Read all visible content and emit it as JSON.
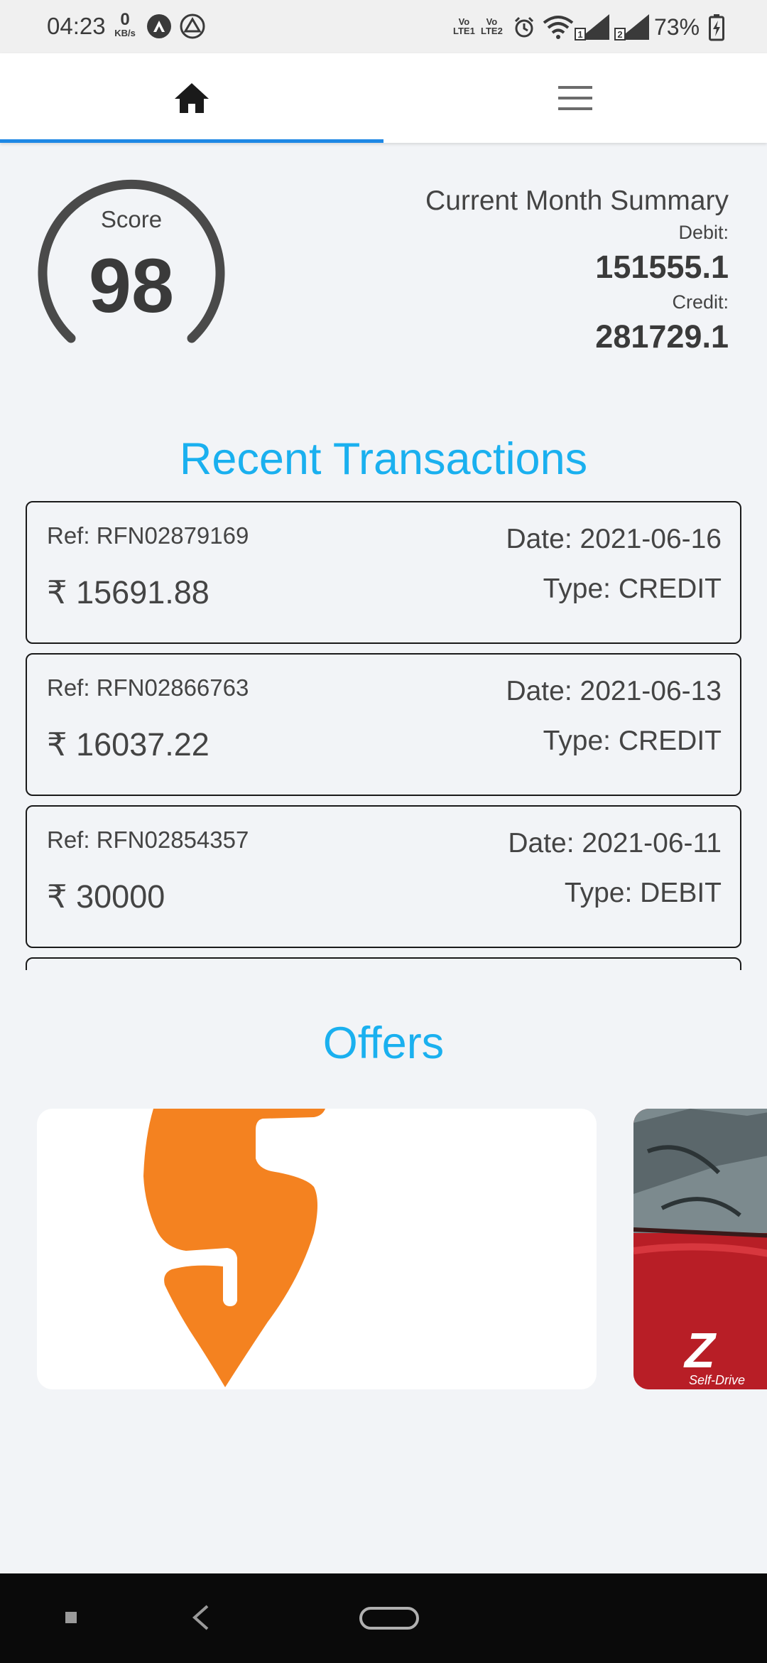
{
  "status_bar": {
    "time": "04:23",
    "net_speed_value": "0",
    "net_speed_unit": "KB/s",
    "volte1": "Vo\nLTE1",
    "volte2": "Vo\nLTE2",
    "battery": "73%",
    "icons": [
      "app-notification-icon",
      "drive-icon",
      "alarm-icon",
      "wifi-icon",
      "signal-sim1-icon",
      "signal-sim2-icon",
      "battery-charging-icon"
    ]
  },
  "nav": {
    "tabs": [
      {
        "name": "home",
        "icon": "home-icon",
        "active": true
      },
      {
        "name": "menu",
        "icon": "menu-icon",
        "active": false
      }
    ],
    "accent": "#1e88e5"
  },
  "score": {
    "label": "Score",
    "value": "98"
  },
  "summary": {
    "title": "Current Month Summary",
    "debit_label": "Debit:",
    "debit_value": "151555.1",
    "credit_label": "Credit:",
    "credit_value": "281729.1"
  },
  "recent_transactions": {
    "heading": "Recent Transactions",
    "items": [
      {
        "ref": "Ref: RFN02879169",
        "amount": "₹ 15691.88",
        "date": "Date: 2021-06-16",
        "type": "Type: CREDIT"
      },
      {
        "ref": "Ref: RFN02866763",
        "amount": "₹ 16037.22",
        "date": "Date: 2021-06-13",
        "type": "Type: CREDIT"
      },
      {
        "ref": "Ref: RFN02854357",
        "amount": "₹ 30000",
        "date": "Date: 2021-06-11",
        "type": "Type: DEBIT"
      }
    ]
  },
  "offers": {
    "heading": "Offers",
    "cards": [
      {
        "name": "swiggy",
        "logo": "swiggy-logo",
        "brand_color": "#f48220"
      },
      {
        "name": "zoomcar",
        "text": "Z",
        "subtext": "Self-Drive",
        "brand_color": "#b81e26"
      }
    ]
  },
  "colors": {
    "heading_blue": "#1ab0ef",
    "background": "#f2f4f7",
    "gauge": "#4a4a4a"
  }
}
